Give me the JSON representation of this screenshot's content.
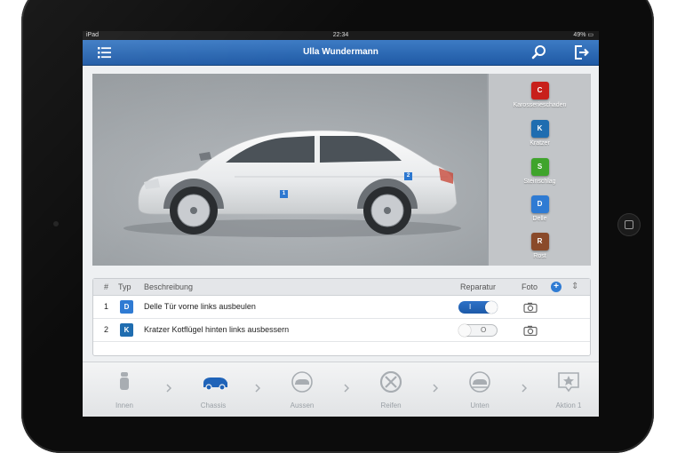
{
  "status_bar": {
    "device": "iPad",
    "time": "22:34",
    "battery": "49%"
  },
  "navbar": {
    "title": "Ulla Wundermann",
    "menu_icon": "list-icon",
    "search_icon": "search-icon",
    "logout_icon": "logout-icon"
  },
  "car_markers": [
    {
      "label": "1"
    },
    {
      "label": "2"
    }
  ],
  "damage_types": [
    {
      "code": "C",
      "label": "Karosserieschaden",
      "color": "#c8201b"
    },
    {
      "code": "K",
      "label": "Kratzer",
      "color": "#1f6db0"
    },
    {
      "code": "S",
      "label": "Steinschlag",
      "color": "#3fa42c"
    },
    {
      "code": "D",
      "label": "Delle",
      "color": "#2f7bd3"
    },
    {
      "code": "R",
      "label": "Rost",
      "color": "#8a4a2a"
    }
  ],
  "table": {
    "headers": {
      "num": "#",
      "type": "Typ",
      "desc": "Beschreibung",
      "repair": "Reparatur",
      "photo": "Foto"
    },
    "rows": [
      {
        "num": "1",
        "type": "D",
        "desc": "Delle Tür vorne links ausbeulen",
        "repair": true,
        "repair_mark": "I"
      },
      {
        "num": "2",
        "type": "K",
        "desc": "Kratzer Kotflügel hinten links ausbessern",
        "repair": false,
        "repair_mark": "O"
      }
    ]
  },
  "steps": [
    {
      "label": "Innen",
      "icon": "seat-icon",
      "active": false
    },
    {
      "label": "Chassis",
      "icon": "car-chassis-icon",
      "active": true
    },
    {
      "label": "Aussen",
      "icon": "car-outside-icon",
      "active": false
    },
    {
      "label": "Reifen",
      "icon": "tire-icon",
      "active": false
    },
    {
      "label": "Unten",
      "icon": "car-under-icon",
      "active": false
    },
    {
      "label": "Aktion 1",
      "icon": "star-bubble-icon",
      "active": false
    }
  ]
}
